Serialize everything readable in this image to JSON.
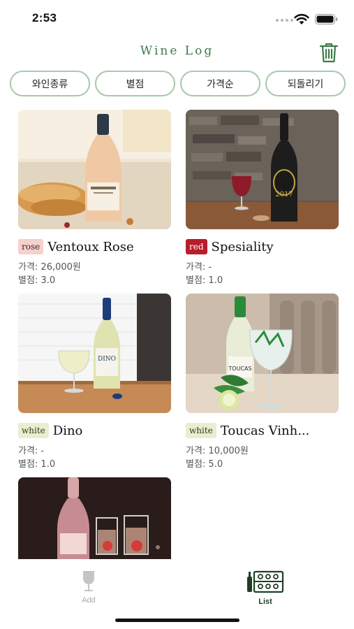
{
  "status_bar": {
    "time": "2:53"
  },
  "header": {
    "title": "Wine Log"
  },
  "filters": [
    {
      "label": "와인종류"
    },
    {
      "label": "별점"
    },
    {
      "label": "가격순"
    },
    {
      "label": "되돌리기"
    }
  ],
  "wines": [
    {
      "type": "rose",
      "name": "Ventoux Rose",
      "price": "가격: 26,000원",
      "rating": "별점: 3.0"
    },
    {
      "type": "red",
      "name": "Spesiality",
      "price": "가격: -",
      "rating": "별점: 1.0"
    },
    {
      "type": "white",
      "name": "Dino",
      "price": "가격: -",
      "rating": "별점: 1.0"
    },
    {
      "type": "white",
      "name": "Toucas Vinh...",
      "price": "가격: 10,000원",
      "rating": "별점: 5.0"
    }
  ],
  "tabs": {
    "add_label": "Add",
    "list_label": "List"
  },
  "colors": {
    "accent": "#3f7a48",
    "border": "#a9c8ad",
    "red_badge": "#b81d2a",
    "rose_badge": "#f6d0cc",
    "white_badge": "#e8efd0"
  }
}
